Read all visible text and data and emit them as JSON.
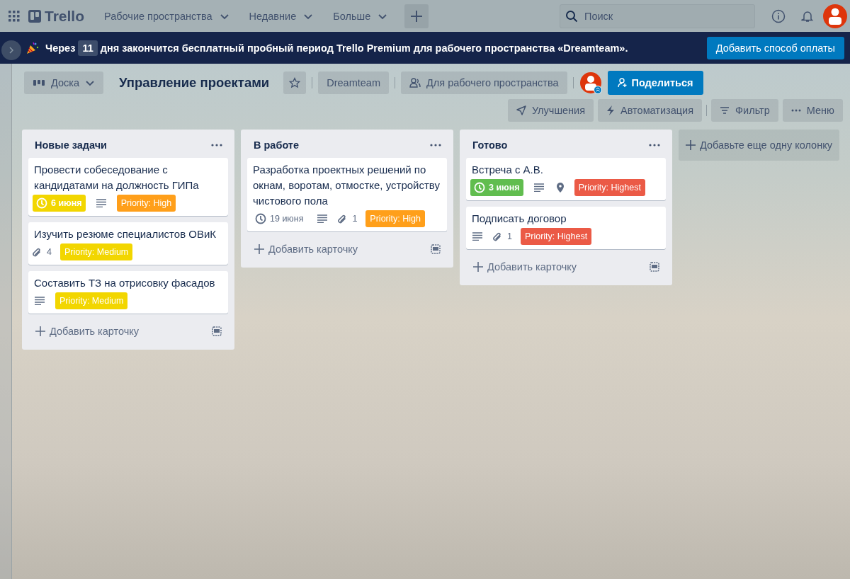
{
  "top_bar": {
    "logo": "Trello",
    "menus": [
      {
        "label": "Рабочие пространства"
      },
      {
        "label": "Недавние"
      },
      {
        "label": "Больше"
      }
    ],
    "search": {
      "placeholder": "Поиск"
    }
  },
  "banner": {
    "text_before": "Через",
    "days": "11",
    "text_after": "дня закончится бесплатный пробный период Trello Premium для рабочего пространства «Dreamteam».",
    "button": "Добавить способ оплаты"
  },
  "board_header": {
    "view_button": "Доска",
    "title": "Управление проектами",
    "workspace": "Dreamteam",
    "visibility": "Для рабочего пространства",
    "share_button": "Поделиться",
    "actions": [
      {
        "kind": "power-ups",
        "label": "Улучшения"
      },
      {
        "kind": "automation",
        "label": "Автоматизация"
      },
      {
        "kind": "filter",
        "label": "Фильтр"
      },
      {
        "kind": "menu",
        "label": "Меню"
      }
    ]
  },
  "lists": [
    {
      "title": "Новые задачи",
      "add_card": "Добавить карточку",
      "cards": [
        {
          "title": "Провести собеседование с кандидатами на должность ГИПа",
          "badges": [
            {
              "kind": "due",
              "text": "6 июня",
              "due_soon": true,
              "complete": false
            },
            {
              "kind": "description"
            },
            {
              "kind": "label",
              "text": "Priority: High",
              "color": "#ff9f1a"
            }
          ]
        },
        {
          "title": "Изучить резюме специалистов ОВиК",
          "badges": [
            {
              "kind": "attachments",
              "text": "4"
            },
            {
              "kind": "label",
              "text": "Priority: Medium",
              "color": "#f2d600"
            }
          ]
        },
        {
          "title": "Составить ТЗ на отрисовку фасадов",
          "badges": [
            {
              "kind": "description"
            },
            {
              "kind": "label",
              "text": "Priority: Medium",
              "color": "#f2d600"
            }
          ]
        }
      ]
    },
    {
      "title": "В работе",
      "add_card": "Добавить карточку",
      "cards": [
        {
          "title": "Разработка проектных решений по окнам, воротам, отмостке, устройству чистового пола",
          "badges": [
            {
              "kind": "due",
              "text": "19 июня",
              "due_soon": false,
              "complete": false
            },
            {
              "kind": "description"
            },
            {
              "kind": "attachments",
              "text": "1"
            },
            {
              "kind": "label",
              "text": "Priority: High",
              "color": "#ff9f1a"
            }
          ]
        }
      ]
    },
    {
      "title": "Готово",
      "add_card": "Добавить карточку",
      "cards": [
        {
          "title": "Встреча с А.В.",
          "badges": [
            {
              "kind": "due",
              "text": "3 июня",
              "due_soon": false,
              "complete": true
            },
            {
              "kind": "description"
            },
            {
              "kind": "location"
            },
            {
              "kind": "label",
              "text": "Priority: Highest",
              "color": "#eb5a46"
            }
          ]
        },
        {
          "title": "Подписать договор",
          "badges": [
            {
              "kind": "description"
            },
            {
              "kind": "attachments",
              "text": "1"
            },
            {
              "kind": "label",
              "text": "Priority: Highest",
              "color": "#eb5a46"
            }
          ]
        }
      ]
    }
  ],
  "add_list": "Добавьте еще одну колонку"
}
